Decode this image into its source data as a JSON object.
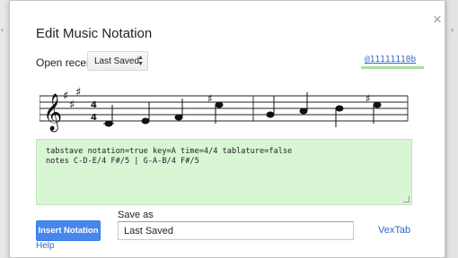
{
  "dialog": {
    "title": "Edit Music Notation",
    "close_glyph": "×",
    "open_recent_label": "Open recent",
    "open_recent_selected": "Last Saved",
    "user_tag": "@11111110b",
    "editor_lines": [
      "tabstave notation=true key=A time=4/4 tablature=false",
      "notes C-D-E/4 F#/5 | G-A-B/4 F#/5"
    ],
    "insert_button_label": "Insert Notation",
    "help_label": "Help",
    "save_as_label": "Save as",
    "save_as_value": "Last Saved",
    "vextab_label": "VexTab"
  },
  "staff": {
    "clef": "treble",
    "key_signature": "A major (3 sharps)",
    "time_signature": "4/4",
    "measures": [
      [
        "C/4",
        "D/4",
        "E/4",
        "F#/5"
      ],
      [
        "G/4",
        "A/4",
        "B/4",
        "F#/5"
      ]
    ]
  },
  "colors": {
    "link": "#3366cc",
    "primary_button": "#4787ed",
    "editor_background": "#d8f5d4",
    "tag_underline": "#a8e0a0"
  }
}
